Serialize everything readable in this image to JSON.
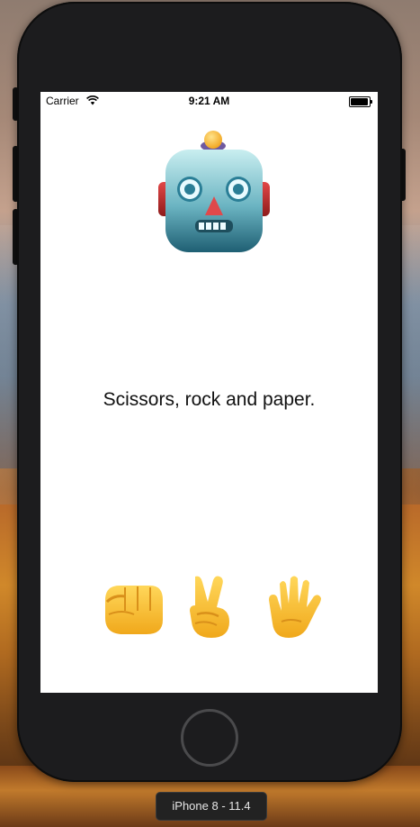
{
  "status_bar": {
    "carrier": "Carrier",
    "time": "9:21 AM",
    "battery_level": 0.95
  },
  "app": {
    "opponent_icon": "robot-face-icon",
    "message": "Scissors, rock and paper.",
    "choices": [
      {
        "name": "rock",
        "icon": "fist-icon"
      },
      {
        "name": "scissors",
        "icon": "victory-hand-icon"
      },
      {
        "name": "paper",
        "icon": "raised-hand-icon"
      }
    ]
  },
  "simulator": {
    "device_label": "iPhone 8 - 11.4"
  },
  "colors": {
    "screen_bg": "#ffffff",
    "device_frame": "#1c1c1e"
  }
}
